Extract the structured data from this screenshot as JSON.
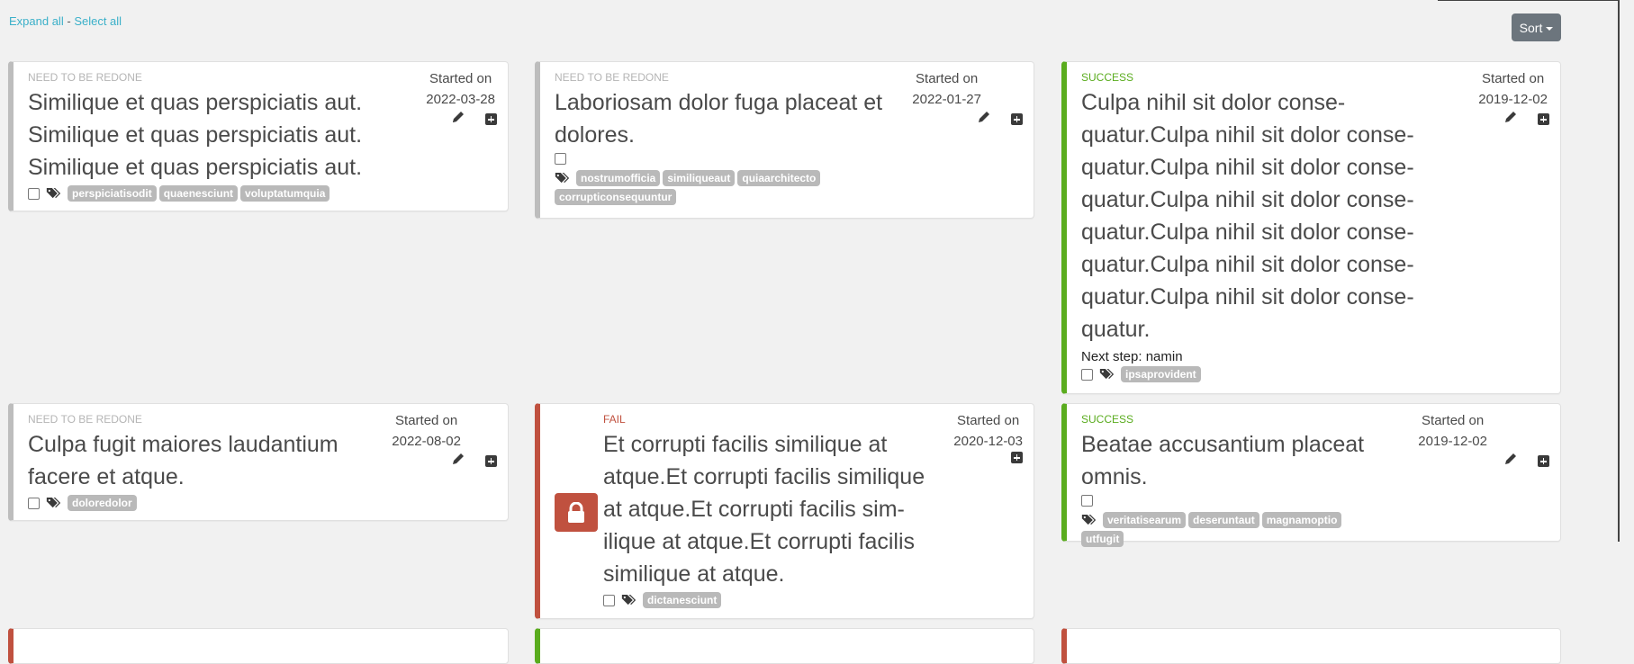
{
  "toolbar": {
    "expand_all": "Expand all",
    "separator": "-",
    "select_all": "Select all",
    "sort_label": "Sort"
  },
  "colors": {
    "success": "#5aac1e",
    "fail": "#c0513f",
    "neutral": "#bdbdbd",
    "link": "#3bb0c9",
    "sort_button": "#6c757d"
  },
  "started_label": "Started on",
  "cards": [
    {
      "status": "NEED TO BE REDONE",
      "title": "Similique et quas perspiciatis aut. Similique et quas perspiciatis aut. Similique et quas perspiciatis aut.",
      "started_on": "2022-03-28",
      "tags": [
        "perspiciatisodit",
        "quaenesciunt",
        "voluptatumquia"
      ]
    },
    {
      "status": "NEED TO BE REDONE",
      "title": "Laboriosam dolor fuga placeat et dolores.",
      "started_on": "2022-01-27",
      "tags": [
        "nostrumofficia",
        "similiqueaut",
        "quiaarchitecto",
        "corrupticonsequuntur"
      ]
    },
    {
      "status": "SUCCESS",
      "title": "Culpa nihil sit dolor conse­quatur.Culpa nihil sit dolor conse­quatur.Culpa nihil sit dolor conse­quatur.Culpa nihil sit dolor conse­quatur.Culpa nihil sit dolor conse­quatur.Culpa nihil sit dolor conse­quatur.Culpa nihil sit dolor conse­quatur.",
      "next_step_label": "Next step:",
      "next_step_value": "namin",
      "started_on": "2019-12-02",
      "tags": [
        "ipsaprovident"
      ]
    },
    {
      "status": "NEED TO BE REDONE",
      "title": "Culpa fugit maiores laudantium facere et atque.",
      "started_on": "2022-08-02",
      "tags": [
        "doloredolor"
      ]
    },
    {
      "status": "FAIL",
      "title": "Et corrupti facilis similique at atque.Et corrupti facilis similique at atque.Et corrupti facilis sim­ilique at atque.Et corrupti facilis similique at atque.",
      "started_on": "2020-12-03",
      "locked": true,
      "tags": [
        "dictanesciunt"
      ]
    },
    {
      "status": "SUCCESS",
      "title": "Beatae accusantium placeat omnis.",
      "started_on": "2019-12-02",
      "tags": [
        "veritatisearum",
        "deseruntaut",
        "magnamoptio",
        "utfugit"
      ]
    }
  ]
}
